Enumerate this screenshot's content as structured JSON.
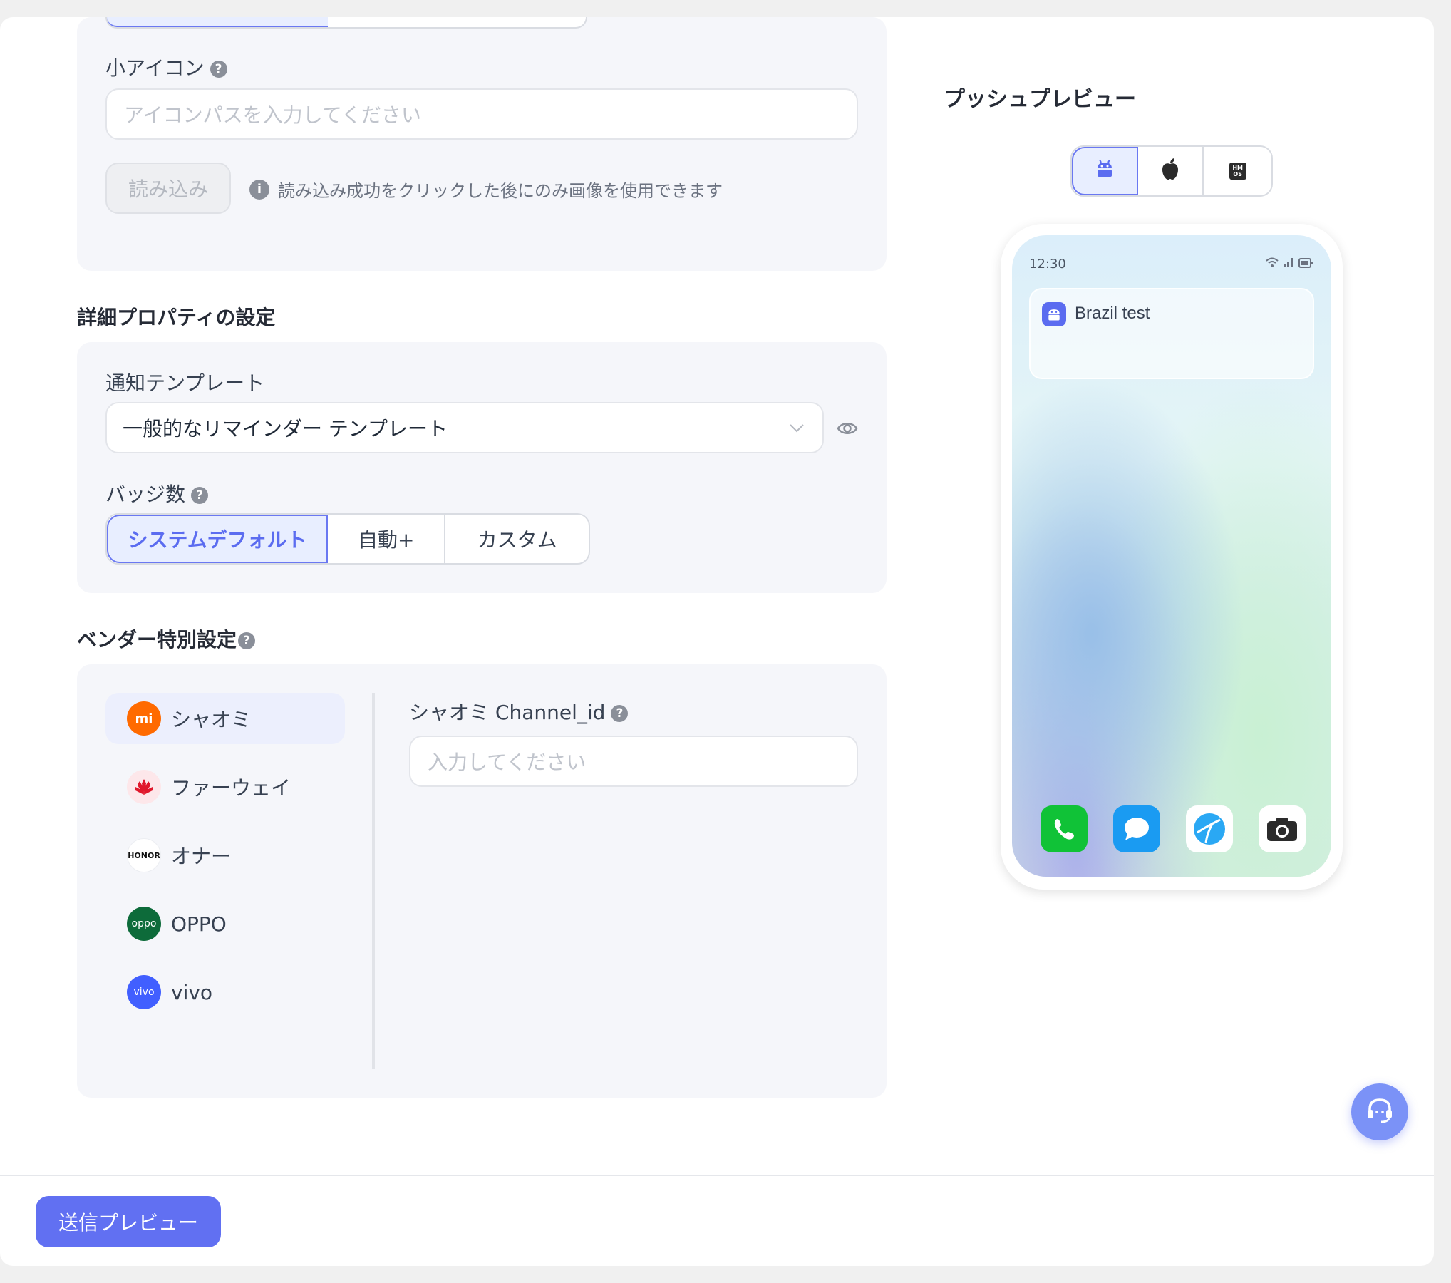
{
  "small_icon": {
    "label": "小アイコン",
    "placeholder": "アイコンパスを入力してください",
    "load_button": "読み込み",
    "hint": "読み込み成功をクリックした後にのみ画像を使用できます"
  },
  "advanced": {
    "heading": "詳細プロパティの設定",
    "template_label": "通知テンプレート",
    "template_value": "一般的なリマインダー テンプレート",
    "badge_label": "バッジ数",
    "badge_options": [
      "システムデフォルト",
      "自動+",
      "カスタム"
    ]
  },
  "vendor": {
    "heading": "ベンダー特別設定",
    "items": [
      "シャオミ",
      "ファーウェイ",
      "オナー",
      "OPPO",
      "vivo"
    ],
    "logos": [
      "mi",
      "",
      "HONOR",
      "oppo",
      "vivo"
    ],
    "field_label": "シャオミ Channel_id",
    "field_placeholder": "入力してください"
  },
  "preview": {
    "heading": "プッシュプレビュー",
    "tabs": [
      "android-icon",
      "apple-icon",
      "harmonyos-icon"
    ],
    "tab_hmos_text": "HM OS",
    "time": "12:30",
    "notification_title": "Brazil test"
  },
  "footer": {
    "send_preview": "送信プレビュー"
  },
  "colors": {
    "accent": "#5b6cf0",
    "xiaomi": "#ff6a00",
    "huawei": "#e0182c",
    "oppo": "#0d6b3a",
    "vivo": "#415fff"
  }
}
